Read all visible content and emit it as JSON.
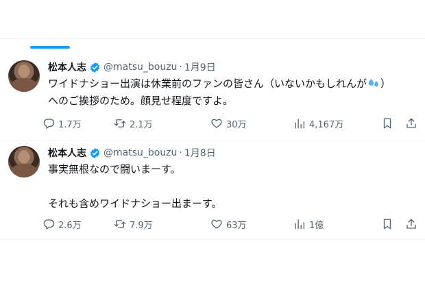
{
  "tweets": [
    {
      "name": "松本人志",
      "handle": "@matsu_bouzu",
      "separator": "·",
      "date": "1月9日",
      "lines": [
        "ワイドナショー出演は休業前のファンの皆さん（いないかもしれんが",
        "へのご挨拶のため。顔見せ程度ですよ。"
      ],
      "line1_suffix": "）",
      "emoji": "sweat-droplets-emoji",
      "stats": {
        "replies": "1.7万",
        "retweets": "2.1万",
        "likes": "30万",
        "views": "4,167万"
      }
    },
    {
      "name": "松本人志",
      "handle": "@matsu_bouzu",
      "separator": "·",
      "date": "1月8日",
      "lines": [
        "事実無根なので闘いまーす。",
        "",
        "それも含めワイドナショー出まーす。"
      ],
      "stats": {
        "replies": "2.6万",
        "retweets": "7.9万",
        "likes": "63万",
        "views": "1億"
      }
    }
  ],
  "more_glyph": "···",
  "colors": {
    "accent": "#1d9bf0",
    "text": "#0f1419",
    "muted": "#536471",
    "border": "#eff3f4"
  }
}
